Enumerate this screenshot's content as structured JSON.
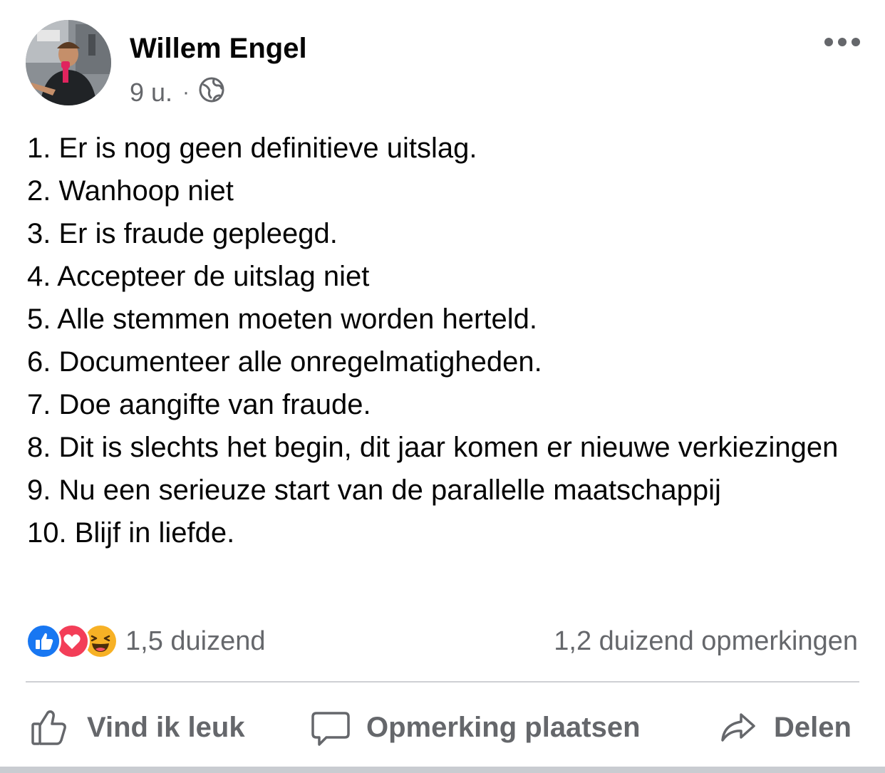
{
  "post": {
    "author": "Willem Engel",
    "time": "9 u.",
    "separator": "·",
    "privacy_icon": "globe-icon",
    "lines": [
      "1. Er is nog geen definitieve uitslag.",
      "2. Wanhoop niet",
      "3. Er is fraude gepleegd.",
      "4. Accepteer de uitslag niet",
      "5. Alle stemmen moeten worden herteld.",
      "6. Documenteer alle onregelmatigheden.",
      "7. Doe aangifte van fraude.",
      "8. Dit is slechts het begin, dit jaar komen er nieuwe verkiezingen",
      "9. Nu een serieuze start van de parallelle maatschappij",
      "10. Blijf in liefde."
    ]
  },
  "reactions": {
    "icons": [
      "like-icon",
      "love-icon",
      "haha-icon"
    ],
    "count": "1,5 duizend",
    "comments": "1,2 duizend opmerkingen"
  },
  "actions": {
    "like": "Vind ik leuk",
    "comment": "Opmerking plaatsen",
    "share": "Delen"
  },
  "colors": {
    "text": "#050505",
    "secondary": "#65676b",
    "like_blue": "#1877f2",
    "love_red": "#f33e58",
    "haha_yellow": "#f7b125"
  }
}
